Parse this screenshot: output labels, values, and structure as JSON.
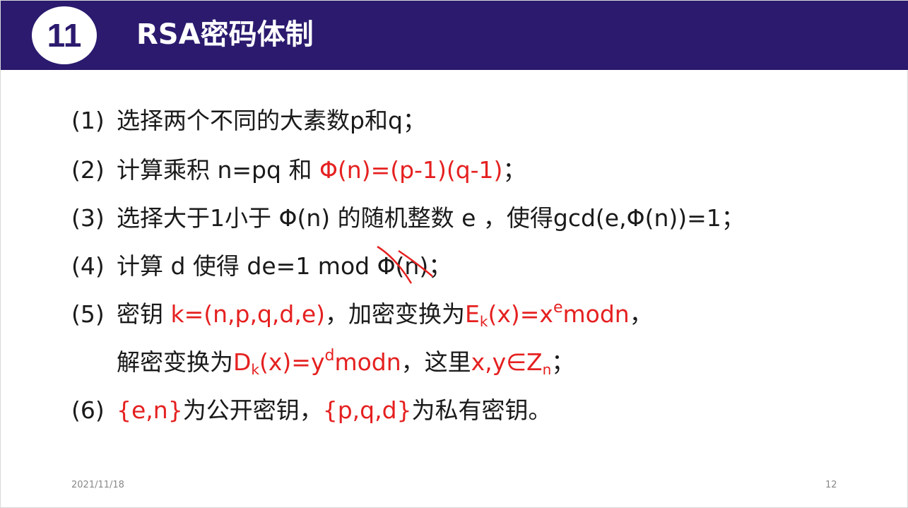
{
  "header": {
    "number": "11",
    "title": "RSA密码体制"
  },
  "steps": [
    {
      "num": "(1)",
      "text": "选择两个不同的大素数p和q；"
    },
    {
      "num": "(2)",
      "pre": "计算乘积 n=pq 和 ",
      "red": "Φ(n)=(p-1)(q-1)",
      "post": "；"
    },
    {
      "num": "(3)",
      "text": "选择大于1小于 Φ(n) 的随机整数 e ，使得gcd(e,Φ(n))=1；"
    },
    {
      "num": "(4)",
      "pre": "计算 d 使得 de=1 mod ",
      "crossed": "Φ(n)",
      "post": "；"
    },
    {
      "num": "(5)",
      "pre": "密钥 ",
      "red1": "k=(n,p,q,d,e)",
      "mid": "，加密变换为",
      "red2_base": "E",
      "red2_sub": "k",
      "red2_mid": "(x)=x",
      "red2_sup": "e",
      "red2_end": "modn",
      "post": "，"
    },
    {
      "pre": "解密变换为",
      "red1_base": "D",
      "red1_sub": "k",
      "red1_mid": "(x)=y",
      "red1_sup": "d",
      "red1_end": "modn",
      "mid": "，这里",
      "red2": "x,y∈Z",
      "red2_sub": "n",
      "post": "；"
    },
    {
      "num": "(6)",
      "red1": "{e,n}",
      "mid": "为公开密钥，",
      "red2": "{p,q,d}",
      "post": "为私有密钥。"
    }
  ],
  "footer": {
    "date": "2021/11/18",
    "page": "12"
  },
  "colors": {
    "header_bg": "#2b1a6e",
    "accent_red": "#e52020",
    "text": "#1a1a1a"
  }
}
